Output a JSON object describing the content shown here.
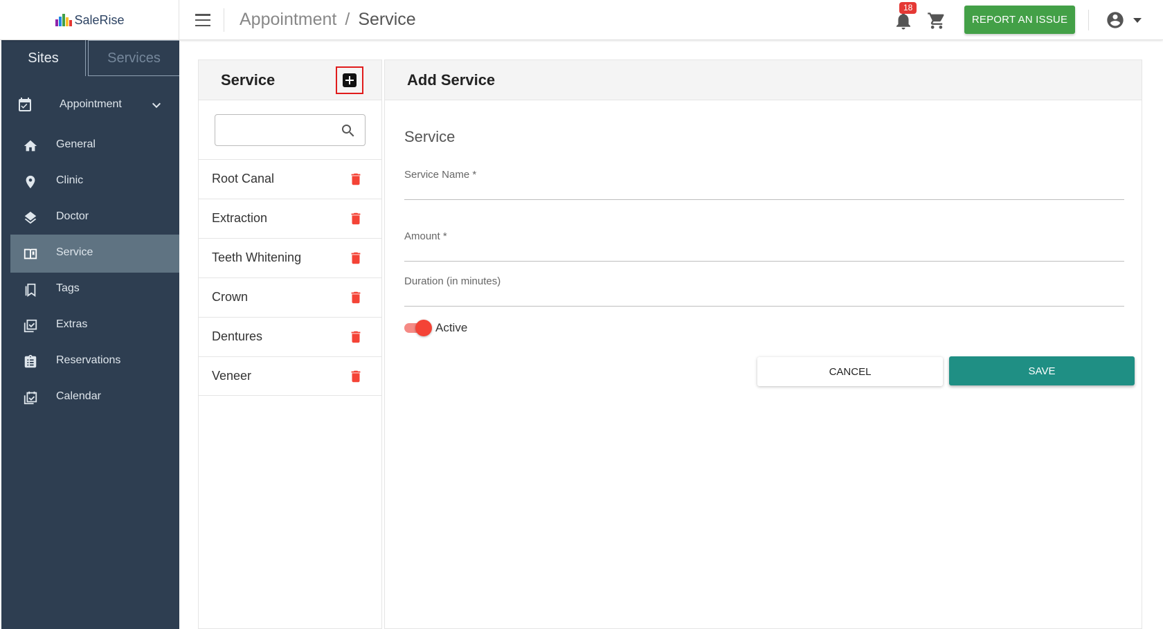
{
  "brand": {
    "name": "SaleRise",
    "logo_colors": [
      "#e53935",
      "#fbc02d",
      "#43a047",
      "#1e88e5",
      "#8e24aa"
    ]
  },
  "header": {
    "breadcrumb_parent": "Appointment",
    "breadcrumb_separator": "/",
    "breadcrumb_current": "Service",
    "notification_count": "18",
    "report_label": "REPORT AN ISSUE",
    "report_color": "#43a047"
  },
  "sidebar": {
    "tabs": [
      {
        "label": "Sites"
      },
      {
        "label": "Services"
      }
    ],
    "group": {
      "label": "Appointment",
      "icon": "calendar-check-icon"
    },
    "items": [
      {
        "label": "General",
        "icon": "home-icon"
      },
      {
        "label": "Clinic",
        "icon": "location-pin-icon"
      },
      {
        "label": "Doctor",
        "icon": "layers-icon"
      },
      {
        "label": "Service",
        "icon": "book-icon",
        "active": true
      },
      {
        "label": "Tags",
        "icon": "bookmark-icon"
      },
      {
        "label": "Extras",
        "icon": "checklist-icon"
      },
      {
        "label": "Reservations",
        "icon": "clipboard-icon"
      },
      {
        "label": "Calendar",
        "icon": "calendar-icon"
      }
    ],
    "colors": {
      "background": "#2e3e51",
      "active": "#5f7382"
    }
  },
  "list_panel": {
    "title": "Service",
    "search_placeholder": "",
    "items": [
      {
        "name": "Root Canal"
      },
      {
        "name": "Extraction"
      },
      {
        "name": "Teeth Whitening"
      },
      {
        "name": "Crown"
      },
      {
        "name": "Dentures"
      },
      {
        "name": "Veneer"
      }
    ],
    "delete_color": "#f44336"
  },
  "form": {
    "title": "Add Service",
    "section_title": "Service",
    "service_name_label": "Service Name *",
    "service_name_value": "",
    "amount_label": "Amount *",
    "amount_value": "",
    "duration_label": "Duration (in minutes)",
    "duration_value": "",
    "active_label": "Active",
    "active_on": true,
    "cancel_label": "CANCEL",
    "save_label": "SAVE",
    "save_color": "#1f8f84"
  }
}
